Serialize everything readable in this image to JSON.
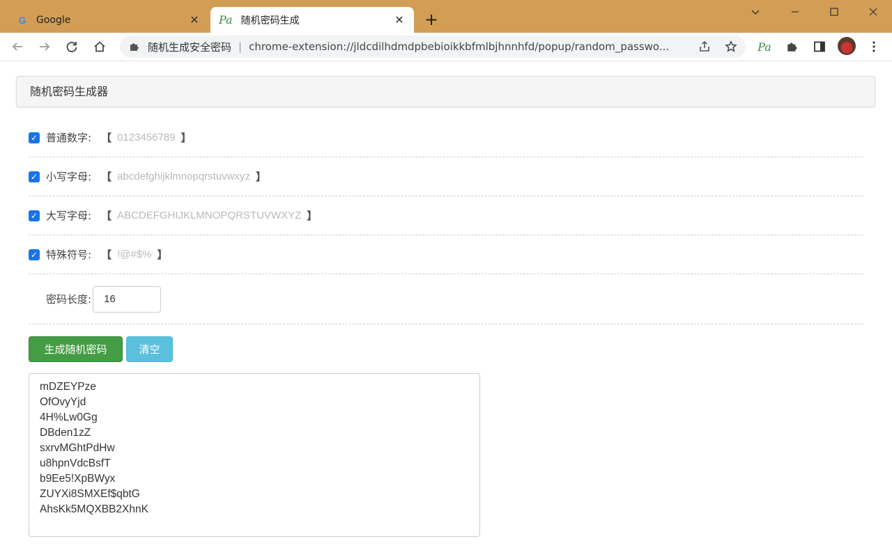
{
  "browser": {
    "tabs": [
      {
        "title": "Google",
        "active": false
      },
      {
        "title": "随机密码生成",
        "active": true
      }
    ],
    "omnibox": {
      "label": "随机生成安全密码",
      "url": "chrome-extension://jldcdilhdmdpbebioikkbfmlbjhnnhfd/popup/random_passwo..."
    },
    "colors": {
      "tabbar": "#d29e55",
      "accent": "#1a73e8"
    }
  },
  "page": {
    "title": "随机密码生成器",
    "options": [
      {
        "label": "普通数字:",
        "open": "【",
        "chars": "0123456789",
        "close": "】",
        "checked": true
      },
      {
        "label": "小写字母:",
        "open": "【",
        "chars": "abcdefghijklmnopqrstuvwxyz",
        "close": "】",
        "checked": true
      },
      {
        "label": "大写字母:",
        "open": "【",
        "chars": "ABCDEFGHIJKLMNOPQRSTUVWXYZ",
        "close": "】",
        "checked": true
      },
      {
        "label": "特殊符号:",
        "open": "【",
        "chars": "!@#$%",
        "close": "】",
        "checked": true
      }
    ],
    "length": {
      "label": "密码长度:",
      "value": "16"
    },
    "buttons": {
      "generate": "生成随机密码",
      "clear": "清空"
    },
    "colors": {
      "generate": "#449d44",
      "clear": "#5bc0de"
    },
    "output_lines": [
      "mDZEYPze",
      "OfOvyYjd",
      "4H%Lw0Gg",
      "DBden1zZ",
      "sxrvMGhtPdHw",
      "u8hpnVdcBsfT",
      "b9Ee5!XpBWyx",
      "ZUYXi8SMXEf$qbtG",
      "AhsKk5MQXBB2XhnK"
    ]
  }
}
